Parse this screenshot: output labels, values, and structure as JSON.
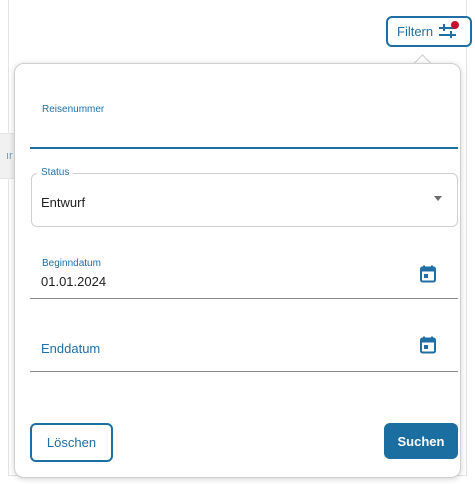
{
  "header": {
    "filter_button_label": "Filtern"
  },
  "background": {
    "partial_text": "ır"
  },
  "filter_panel": {
    "reisenummer": {
      "label": "Reisenummer",
      "value": ""
    },
    "status": {
      "label": "Status",
      "selected": "Entwurf"
    },
    "beginndatum": {
      "label": "Beginndatum",
      "value": "01.01.2024"
    },
    "enddatum": {
      "label": "Enddatum",
      "value": ""
    },
    "buttons": {
      "clear": "Löschen",
      "search": "Suchen"
    }
  },
  "icons": {
    "filter": "tune-sliders-icon",
    "badge": "active-filter-dot",
    "calendar": "calendar-icon",
    "dropdown": "caret-down-icon"
  },
  "colors": {
    "primary": "#1f6fa5",
    "primary_dark": "#1a6ea0",
    "badge": "#c8102e",
    "text": "#222222"
  }
}
